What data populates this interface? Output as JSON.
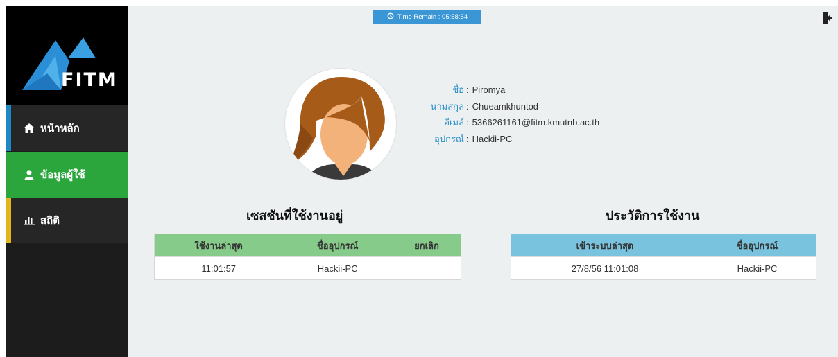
{
  "timer": {
    "label": "Time Remain : 05:58:54"
  },
  "logo": {
    "text": "FITM"
  },
  "sidebar": {
    "items": [
      {
        "label": "หน้าหลัก",
        "icon": "home-icon"
      },
      {
        "label": "ข้อมูลผู้ใช้",
        "icon": "user-icon"
      },
      {
        "label": "สถิติ",
        "icon": "bar-chart-icon"
      }
    ]
  },
  "profile": {
    "first_name_label": "ชื่อ",
    "first_name": "Piromya",
    "last_name_label": "นามสกุล",
    "last_name": "Chueamkhuntod",
    "email_label": "อีเมล์",
    "email": "5366261161@fitm.kmutnb.ac.th",
    "device_label": "อุปกรณ์",
    "device": "Hackii-PC"
  },
  "sessions": {
    "title": "เซสชันที่ใช้งานอยู่",
    "headers": [
      "ใช้งานล่าสุด",
      "ชื่ออุปกรณ์",
      "ยกเลิก"
    ],
    "rows": [
      [
        "11:01:57",
        "Hackii-PC",
        ""
      ]
    ]
  },
  "history": {
    "title": "ประวัติการใช้งาน",
    "headers": [
      "เข้าระบบล่าสุด",
      "ชื่ออุปกรณ์"
    ],
    "rows": [
      [
        "27/8/56 11:01:08",
        "Hackii-PC"
      ]
    ]
  },
  "colors": {
    "timer_bg": "#3a96d4",
    "active_nav": "#2aa63c",
    "home_accent": "#1e88c7",
    "stat_accent": "#e2b61a",
    "label_blue": "#2c8fc9"
  }
}
